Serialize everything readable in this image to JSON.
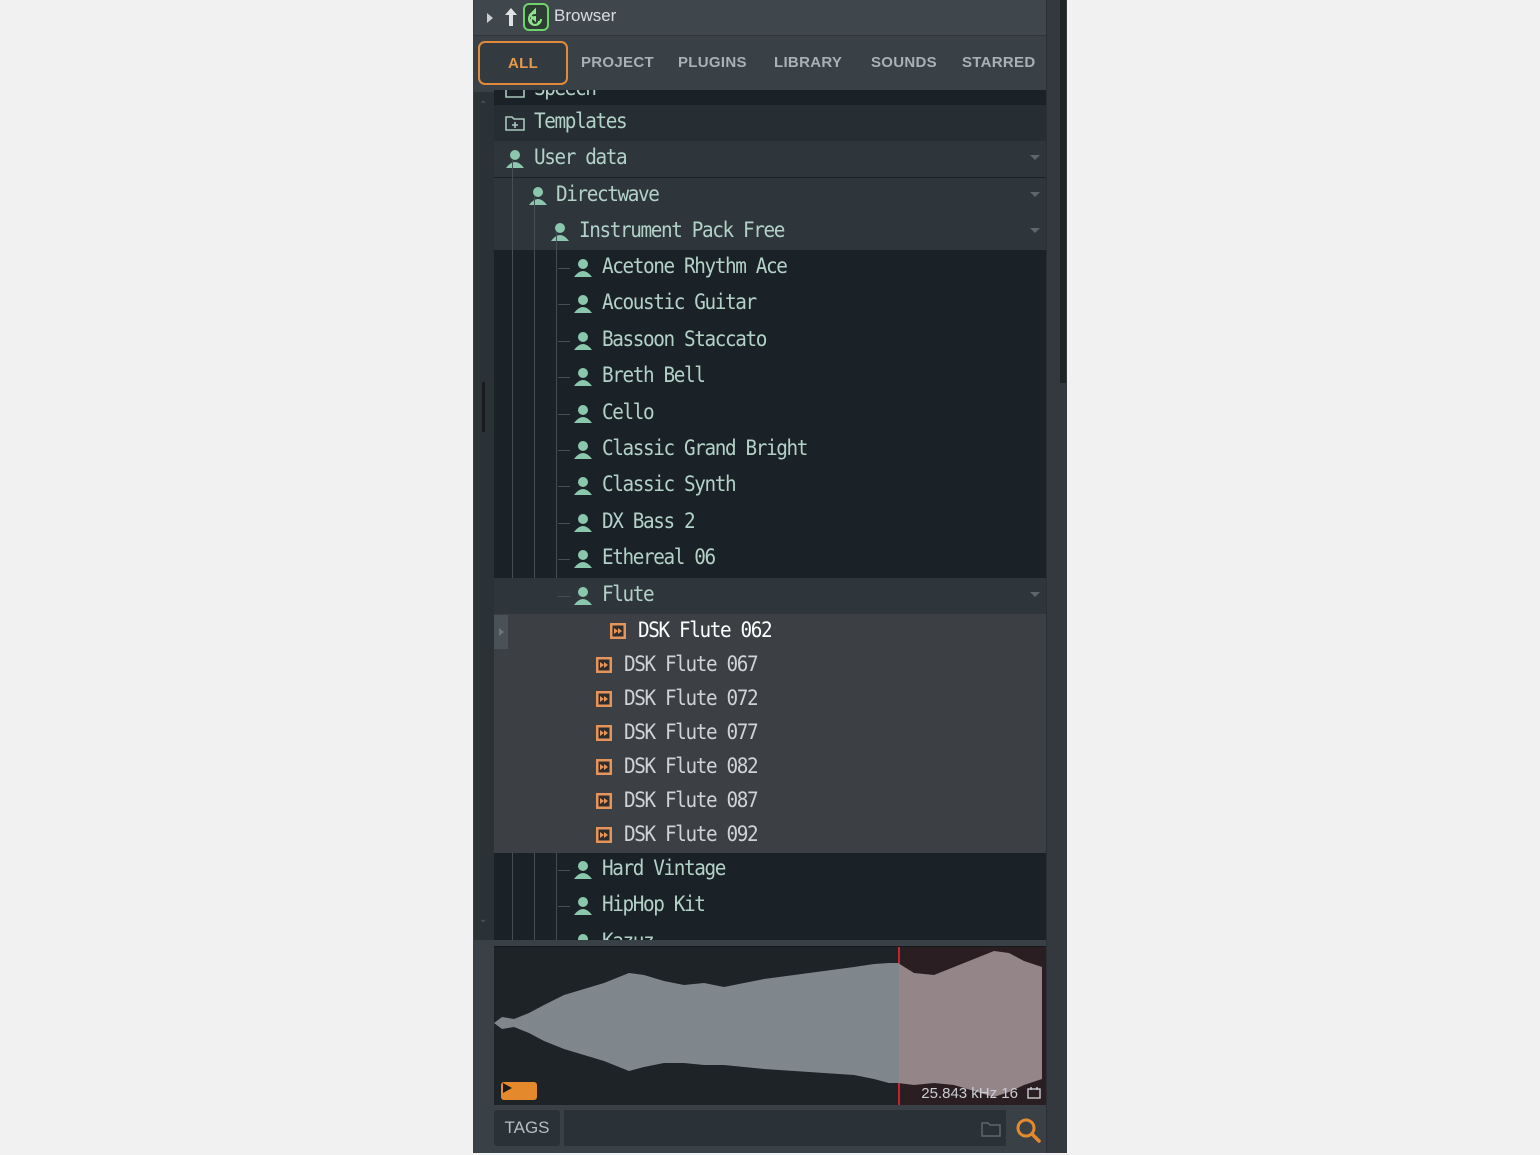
{
  "browser": {
    "title": "Browser"
  },
  "tabs": [
    "ALL",
    "PROJECT",
    "PLUGINS",
    "LIBRARY",
    "SOUNDS",
    "STARRED"
  ],
  "active_tab": "ALL",
  "tree": {
    "partial_top": "Speech",
    "templates": "Templates",
    "user_data": "User data",
    "directwave": "Directwave",
    "instrument_pack": "Instrument Pack Free",
    "instruments_before": [
      "Acetone Rhythm Ace",
      "Acoustic Guitar",
      "Bassoon Staccato",
      "Breth Bell",
      "Cello",
      "Classic Grand Bright",
      "Classic Synth",
      "DX Bass 2",
      "Ethereal 06"
    ],
    "flute": "Flute",
    "flute_files": [
      "DSK Flute 062",
      "DSK Flute 067",
      "DSK Flute 072",
      "DSK Flute 077",
      "DSK Flute 082",
      "DSK Flute 087",
      "DSK Flute 092"
    ],
    "selected_file": "DSK Flute 062",
    "instruments_after": [
      "Hard Vintage",
      "HipHop Kit",
      "Kazuz"
    ]
  },
  "waveform": {
    "info": "25.843 kHz 16"
  },
  "tags": {
    "label": "TAGS",
    "input_value": ""
  },
  "colors": {
    "accent": "#e08a3a",
    "tree_text": "#b3d2c7",
    "selection_marker": "#c4262e",
    "waveform_fill": "#7f878d",
    "waveform_selected_fill": "#948589"
  },
  "icons": {
    "expand": "triangle-right-icon",
    "up": "arrow-up-icon",
    "back": "history-back-icon",
    "folder": "folder-icon",
    "search": "search-icon",
    "user_folder": "user-icon",
    "audio_file": "audio-file-icon"
  }
}
